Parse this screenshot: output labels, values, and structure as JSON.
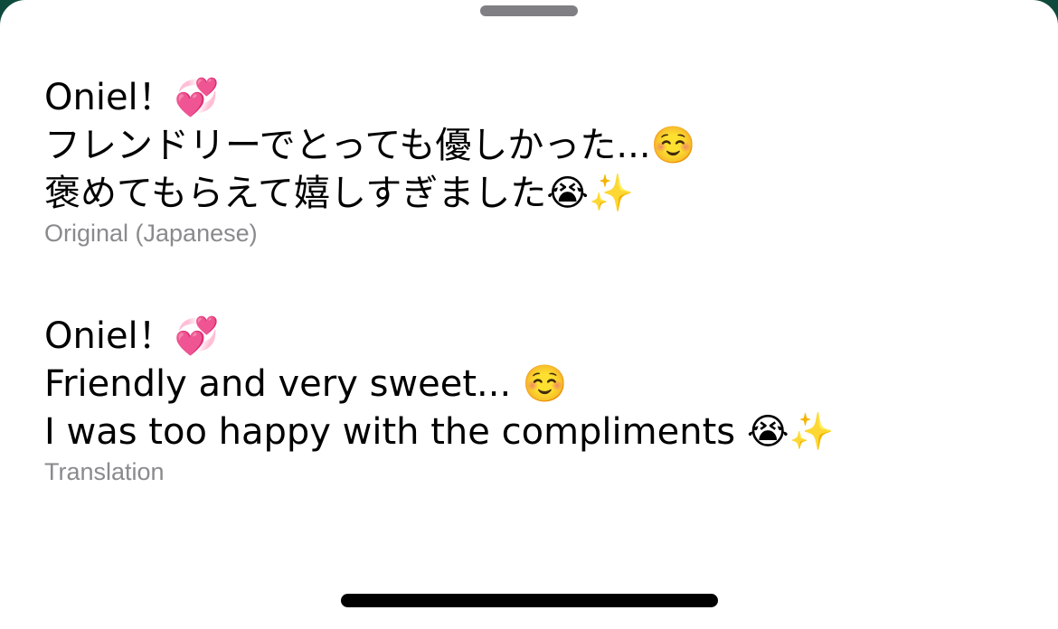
{
  "sheet": {
    "original": {
      "lines": [
        "Oniel！💞",
        "フレンドリーでとっても優しかった...☺️",
        "褒めてもらえて嬉しすぎました😭✨"
      ],
      "caption": "Original (Japanese)"
    },
    "translation": {
      "lines": [
        "Oniel！💞",
        "Friendly and very sweet... ☺️",
        "I was too happy with the compliments 😭✨"
      ],
      "caption": "Translation"
    }
  },
  "colors": {
    "background": "#ffffff",
    "text": "#000000",
    "caption": "#8a8a8e",
    "backdrop": "#0e4a3c"
  }
}
